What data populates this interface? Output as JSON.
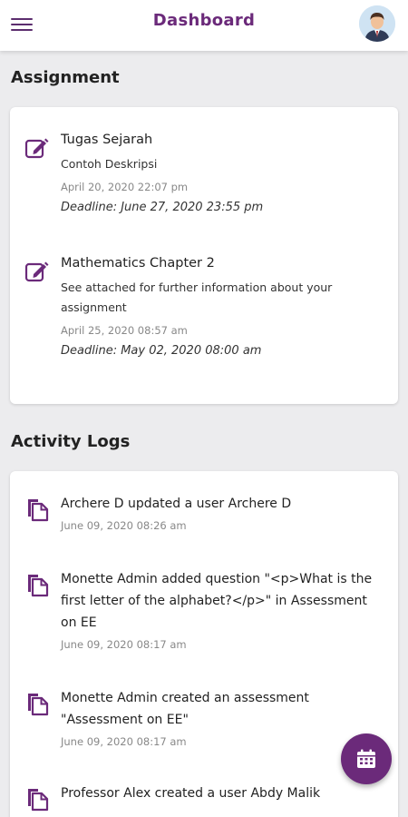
{
  "header": {
    "title": "Dashboard",
    "menu_icon": "hamburger-menu-icon",
    "avatar_icon": "user-avatar"
  },
  "assignments": {
    "section_title": "Assignment",
    "icon": "edit-icon",
    "items": [
      {
        "title": "Tugas Sejarah",
        "description": "Contoh Deskripsi",
        "date": "April 20, 2020 22:07 pm",
        "deadline": "Deadline: June 27, 2020 23:55 pm"
      },
      {
        "title": "Mathematics Chapter 2",
        "description": "See attached for further information about your assignment",
        "date": "April 25, 2020 08:57 am",
        "deadline": "Deadline: May 02, 2020 08:00 am"
      }
    ]
  },
  "activity_logs": {
    "section_title": "Activity Logs",
    "icon": "document-icon",
    "items": [
      {
        "text": "Archere D updated a user Archere D",
        "date": "June 09, 2020 08:26 am"
      },
      {
        "text": "Monette Admin added question \"<p>What is the first letter of the alphabet?</p>\" in Assessment on EE",
        "date": "June 09, 2020 08:17 am"
      },
      {
        "text": "Monette Admin created an assessment \"Assessment on EE\"",
        "date": "June 09, 2020 08:17 am"
      },
      {
        "text": "Professor Alex created a user Abdy Malik",
        "date": ""
      }
    ]
  },
  "fab": {
    "icon": "calendar-icon"
  },
  "colors": {
    "accent": "#6b2a7a",
    "background": "#ececee",
    "card": "#ffffff"
  }
}
